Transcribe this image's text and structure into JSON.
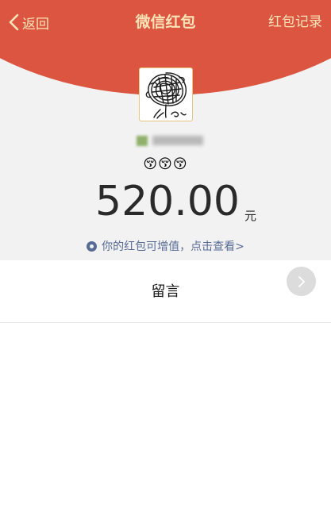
{
  "nav": {
    "back_label": "返回",
    "title": "微信红包",
    "record_label": "红包记录"
  },
  "packet": {
    "emojis": "😚😚😚",
    "amount": "520.00",
    "unit": "元",
    "invest_link": "你的红包可增值，点击查看>"
  },
  "message": {
    "label": "留言"
  },
  "colors": {
    "header_red": "#db5541",
    "header_text": "#fbe3b5",
    "link_blue": "#576b95",
    "panel_gray": "#f2f2f2"
  }
}
